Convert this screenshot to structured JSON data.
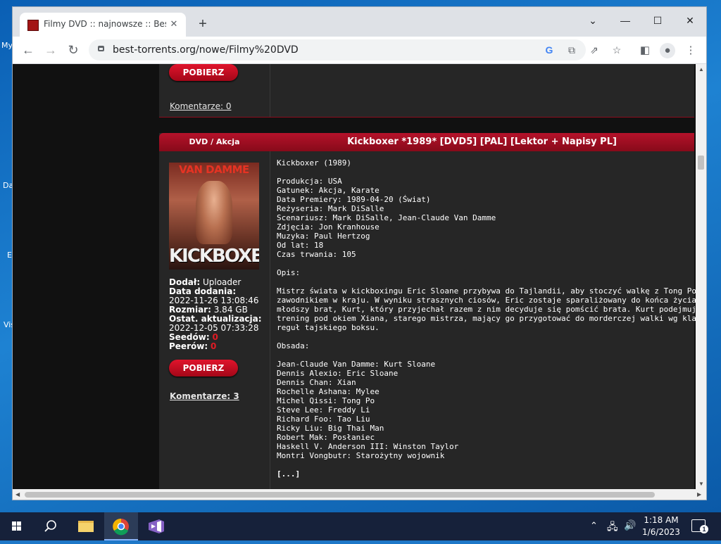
{
  "desktop": {
    "labels": [
      "My",
      "Da",
      "E",
      "Vis"
    ]
  },
  "browser": {
    "tab_title": "Filmy DVD :: najnowsze :: Best-To",
    "url": "best-torrents.org/nowe/Filmy%20DVD"
  },
  "page": {
    "prev_card": {
      "download_label": "POBIERZ",
      "comments_label": "Komentarze: 0"
    },
    "card": {
      "category": "DVD / Akcja",
      "title": "Kickboxer *1989* [DVD5] [PAL] [Lektor + Napisy PL]",
      "poster_top_text": "VAN DAMME",
      "poster_bottom_text": "KICKBOXER",
      "meta": {
        "added_by_label": "Dodał:",
        "added_by": "Uploader",
        "date_added_label": "Data dodania:",
        "date_added": "2022-11-26 13:08:46",
        "size_label": "Rozmiar:",
        "size": "3.84 GB",
        "updated_label": "Ostat. aktualizacja:",
        "updated": "2022-12-05 07:33:28",
        "seeds_label": "Seedów:",
        "seeds": "0",
        "peers_label": "Peerów:",
        "peers": "0"
      },
      "download_label": "POBIERZ",
      "comments_label": "Komentarze: 3",
      "description": {
        "heading": "Kickboxer (1989)",
        "production": "Produkcja: USA",
        "genre": "Gatunek: Akcja, Karate",
        "premiere": "Data Premiery: 1989-04-20 (Świat)",
        "director": "Reżyseria: Mark DiSalle",
        "writers": "Scenariusz: Mark DiSalle, Jean-Claude Van Damme",
        "cinematography": "Zdjęcia: Jon Kranhouse",
        "music": "Muzyka: Paul Hertzog",
        "age": "Od lat: 18",
        "runtime": "Czas trwania: 105",
        "synopsis_label": "Opis:",
        "synopsis_lines": [
          "Mistrz świata w kickboxingu Eric Sloane przybywa do Tajlandii, aby stoczyć walkę z Tong Po, najlepszym",
          "zawodnikiem w kraju. W wyniku strasznych ciosów, Eric zostaje sparaliżowany do końca życia. Jego",
          "młodszy brat, Kurt, który przyjechał razem z nim decyduje się pomścić brata. Kurt podejmuje bardzo cięż",
          "trening pod okiem Xiana, starego mistrza, mający go przygotować do morderczej walki wg klasycznych",
          "reguł tajskiego boksu."
        ],
        "cast_label": "Obsada:",
        "cast": [
          "Jean-Claude Van Damme: Kurt Sloane",
          "Dennis Alexio: Eric Sloane",
          "Dennis Chan: Xian",
          "Rochelle Ashana: Mylee",
          "Michel Qissi: Tong Po",
          "Steve Lee: Freddy Li",
          "Richard Foo: Tao Liu",
          "Ricky Liu: Big Thai Man",
          "Robert Mak: Posłaniec",
          "Haskell V. Anderson III: Winston Taylor",
          "Montri Vongbutr: Starożytny wojownik"
        ],
        "more": "[...]"
      }
    }
  },
  "taskbar": {
    "time": "1:18 AM",
    "date": "1/6/2023",
    "notification_count": "1"
  }
}
